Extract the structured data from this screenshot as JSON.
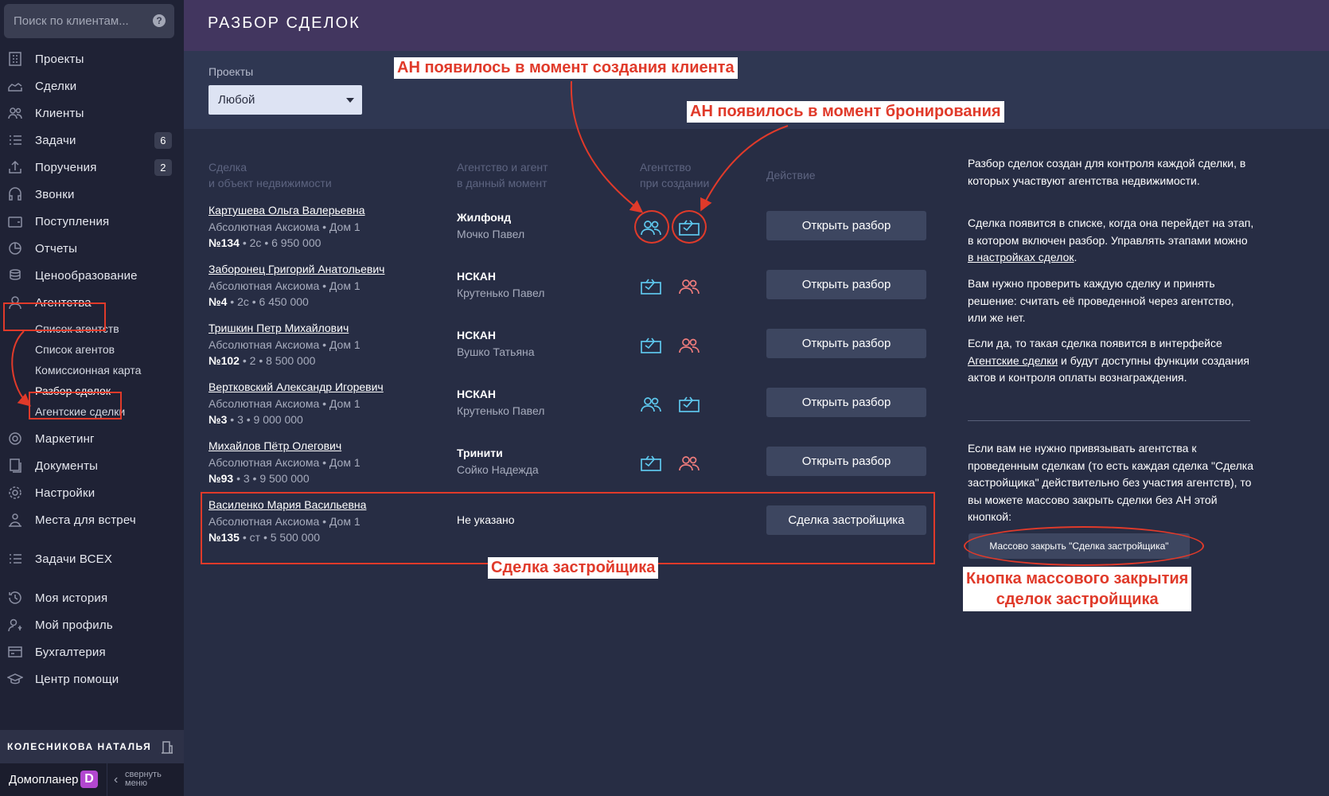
{
  "search": {
    "placeholder": "Поиск по клиентам..."
  },
  "sidebar": {
    "items": [
      {
        "label": "Проекты"
      },
      {
        "label": "Сделки"
      },
      {
        "label": "Клиенты"
      },
      {
        "label": "Задачи",
        "badge": "6"
      },
      {
        "label": "Поручения",
        "badge": "2"
      },
      {
        "label": "Звонки"
      },
      {
        "label": "Поступления"
      },
      {
        "label": "Отчеты"
      },
      {
        "label": "Ценообразование"
      },
      {
        "label": "Агентства"
      },
      {
        "label": "Маркетинг"
      },
      {
        "label": "Документы"
      },
      {
        "label": "Настройки"
      },
      {
        "label": "Места для встреч"
      },
      {
        "label": "Задачи ВСЕХ"
      },
      {
        "label": "Моя история"
      },
      {
        "label": "Мой профиль"
      },
      {
        "label": "Бухгалтерия"
      },
      {
        "label": "Центр помощи"
      }
    ],
    "sub_items": [
      {
        "label": "Список агентств"
      },
      {
        "label": "Список агентов"
      },
      {
        "label": "Комиссионная карта"
      },
      {
        "label": "Разбор сделок"
      },
      {
        "label": "Агентские сделки"
      }
    ],
    "user_name": "КОЛЕСНИКОВА НАТАЛЬЯ",
    "logo_text": "Домопланер",
    "logo_letter": "D",
    "collapse_line1": "свернуть",
    "collapse_line2": "меню"
  },
  "header": {
    "title": "РАЗБОР СДЕЛОК"
  },
  "filter": {
    "label": "Проекты",
    "value": "Любой"
  },
  "table": {
    "headers": {
      "deal_line1": "Сделка",
      "deal_line2": "и объект недвижимости",
      "agency_line1": "Агентство и агент",
      "agency_line2": "в данный момент",
      "creation_line1": "Агентство",
      "creation_line2": "при создании",
      "action": "Действие"
    },
    "rows": [
      {
        "name": "Картушева Ольга Валерьевна",
        "object": "Абсолютная Аксиома • Дом 1",
        "num": "№134",
        "details": " • 2с • 6 950 000",
        "agency": "Жилфонд",
        "agent": "Мочко Павел",
        "action": "Открыть разбор"
      },
      {
        "name": "Заборонец Григорий Анатольевич",
        "object": "Абсолютная Аксиома • Дом 1",
        "num": "№4",
        "details": " • 2с • 6 450 000",
        "agency": "НСКАН",
        "agent": "Крутенько Павел",
        "action": "Открыть разбор"
      },
      {
        "name": "Тришкин Петр Михайлович",
        "object": "Абсолютная Аксиома • Дом 1",
        "num": "№102",
        "details": " • 2 • 8 500 000",
        "agency": "НСКАН",
        "agent": "Вушко Татьяна",
        "action": "Открыть разбор"
      },
      {
        "name": "Вертковский Александр Игоревич",
        "object": "Абсолютная Аксиома • Дом 1",
        "num": "№3",
        "details": " • 3 • 9 000 000",
        "agency": "НСКАН",
        "agent": "Крутенько Павел",
        "action": "Открыть разбор"
      },
      {
        "name": "Михайлов Пётр Олегович",
        "object": "Абсолютная Аксиома • Дом 1",
        "num": "№93",
        "details": " • 3 • 9 500 000",
        "agency": "Тринити",
        "agent": "Сойко Надежда",
        "action": "Открыть разбор"
      },
      {
        "name": "Василенко Мария Васильевна",
        "object": "Абсолютная Аксиома • Дом 1",
        "num": "№135",
        "details": " • ст • 5 500 000",
        "agency": "Не указано",
        "agent": "",
        "action": "Сделка застройщика"
      }
    ]
  },
  "info": {
    "p1": "Разбор сделок создан для контроля каждой сделки, в которых участвуют агентства недвижимости.",
    "p2_a": "Сделка появится в списке, когда она перейдет на этап, в котором включен разбор. Управлять этапами можно ",
    "p2_link": "в настройках сделок",
    "p2_b": ".",
    "p3": "Вам нужно проверить каждую сделку и принять решение: считать её проведенной через агентство, или же нет.",
    "p4_a": "Если да, то такая сделка появится в интерфейсе ",
    "p4_link": "Агентские сделки",
    "p4_b": " и будут доступны функции создания актов и контроля оплаты вознаграждения.",
    "p5": "Если вам не нужно привязывать агентства к проведенным сделкам (то есть каждая сделка \"Сделка застройщика\" действительно без участия агентств), то вы можете массово закрыть сделки без АН этой кнопкой:",
    "mass_button": "Массово закрыть \"Сделка застройщика\""
  },
  "annotations": {
    "a1": "АН появилось в момент создания клиента",
    "a2": "АН появилось в момент бронирования",
    "a3": "Сделка застройщика",
    "a4_line1": "Кнопка массового закрытия",
    "a4_line2": "сделок застройщика"
  },
  "colors": {
    "icon_blue": "#5ec8ee",
    "icon_red": "#ef7c7c",
    "annotation_red": "#e03a2a"
  }
}
